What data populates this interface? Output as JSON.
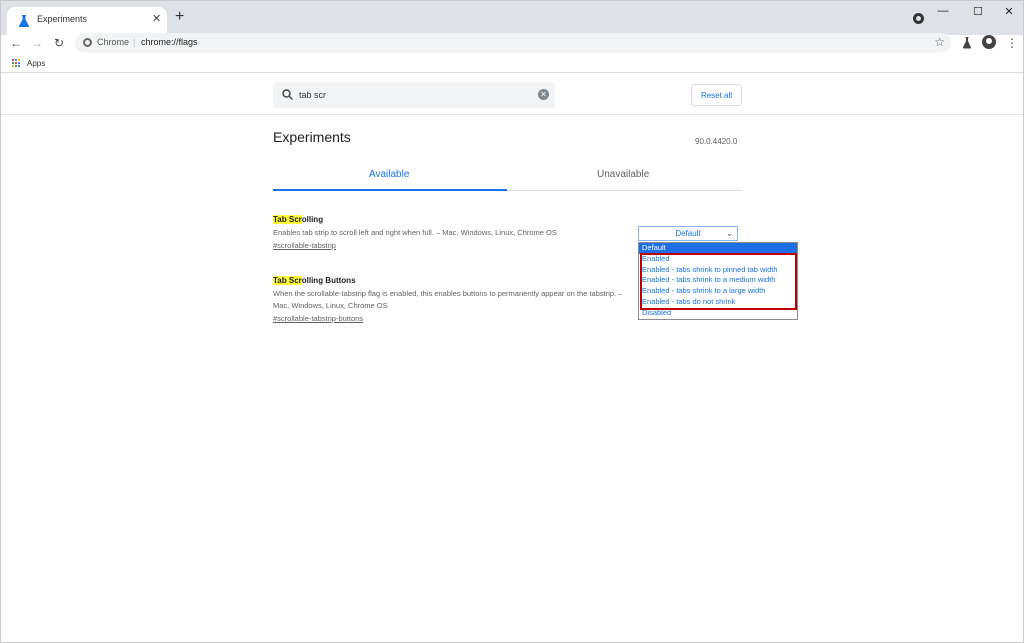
{
  "browser": {
    "tab_title": "Experiments",
    "address_scheme": "Chrome",
    "address_url": "chrome://flags",
    "bookmarks_apps_label": "Apps"
  },
  "search": {
    "value": "tab scr"
  },
  "header": {
    "reset_label": "Reset all"
  },
  "main": {
    "title": "Experiments",
    "version": "90.0.4420.0",
    "tabs": [
      {
        "label": "Available"
      },
      {
        "label": "Unavailable"
      }
    ]
  },
  "flags": [
    {
      "title_highlight": "Tab Scr",
      "title_rest": "olling",
      "description": "Enables tab strip to scroll left and right when full. – Mac, Windows, Linux, Chrome OS",
      "link": "#scrollable-tabstrip",
      "select_value": "Default",
      "options": [
        "Default",
        "Enabled",
        "Enabled - tabs shrink to pinned tab width",
        "Enabled - tabs shrink to a medium width",
        "Enabled - tabs shrink to a large width",
        "Enabled - tabs do not shrink",
        "Disabled"
      ]
    },
    {
      "title_highlight": "Tab Scr",
      "title_rest": "olling Buttons",
      "description": "When the scrollable-tabstrip flag is enabled, this enables buttons to permanently appear on the tabstrip. – Mac, Windows, Linux, Chrome OS",
      "link": "#scrollable-tabstrip-buttons"
    }
  ],
  "colors": {
    "accent": "#1a73e8",
    "highlight": "#fffd38",
    "annotation_box": "#c00000"
  }
}
